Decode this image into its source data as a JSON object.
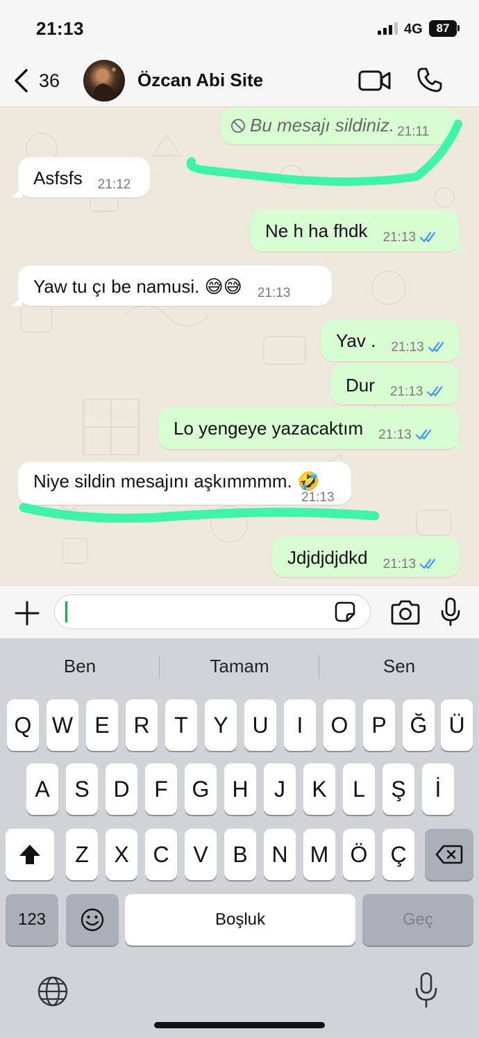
{
  "status_bar": {
    "time": "21:13",
    "network": "4G",
    "battery": "87"
  },
  "header": {
    "back_count": "36",
    "contact_name": "Özcan Abi Site"
  },
  "messages": [
    {
      "dir": "out",
      "text": "Bu mesajı sildiniz.",
      "time": "21:11",
      "deleted": true
    },
    {
      "dir": "in",
      "text": "Asfsfs",
      "time": "21:12"
    },
    {
      "dir": "out",
      "text": "Ne h ha fhdk",
      "time": "21:13"
    },
    {
      "dir": "in",
      "text": "Yaw tu çı be namusi. 😅😅",
      "time": "21:13"
    },
    {
      "dir": "out",
      "text": "Yav .",
      "time": "21:13"
    },
    {
      "dir": "out",
      "text": "Dur",
      "time": "21:13"
    },
    {
      "dir": "out",
      "text": "Lo yengeye yazacaktım",
      "time": "21:13"
    },
    {
      "dir": "in",
      "text": "Niye sildin mesajını aşkımmmm. 🤣",
      "time": "21:13"
    },
    {
      "dir": "out",
      "text": "Jdjdjdjdkd",
      "time": "21:13"
    }
  ],
  "input": {
    "value": ""
  },
  "keyboard": {
    "predictions": [
      "Ben",
      "Tamam",
      "Sen"
    ],
    "row1": [
      "Q",
      "W",
      "E",
      "R",
      "T",
      "Y",
      "U",
      "I",
      "O",
      "P",
      "Ğ",
      "Ü"
    ],
    "row2": [
      "A",
      "S",
      "D",
      "F",
      "G",
      "H",
      "J",
      "K",
      "L",
      "Ş",
      "İ"
    ],
    "row3": [
      "Z",
      "X",
      "C",
      "V",
      "B",
      "N",
      "M",
      "Ö",
      "Ç"
    ],
    "numbers_label": "123",
    "space_label": "Boşluk",
    "return_label": "Geç"
  },
  "colors": {
    "outgoing_bubble": "#d9fdd3",
    "incoming_bubble": "#ffffff",
    "chat_background": "#efe8dc",
    "highlighter": "#3df5a6",
    "read_ticks": "#3497f9"
  }
}
